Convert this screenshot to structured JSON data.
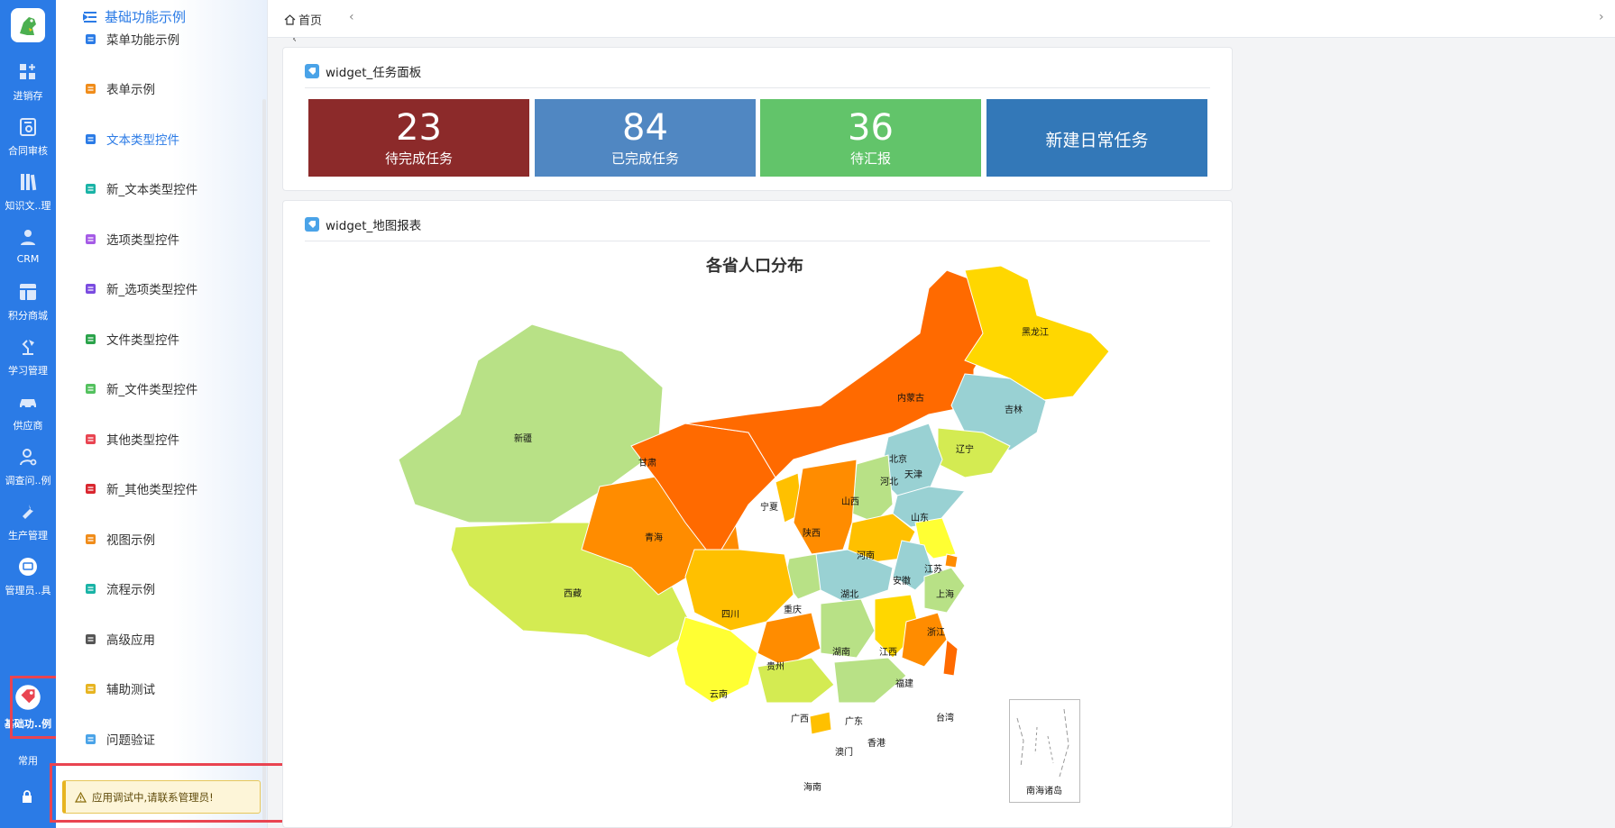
{
  "rail": {
    "items": [
      {
        "label": "进销存",
        "icon": "grid-plus-icon"
      },
      {
        "label": "合同审核",
        "icon": "contract-icon"
      },
      {
        "label": "知识文..理",
        "icon": "books-icon"
      },
      {
        "label": "CRM",
        "icon": "users-icon"
      },
      {
        "label": "积分商城",
        "icon": "layout-icon"
      },
      {
        "label": "学习管理",
        "icon": "lamp-icon"
      },
      {
        "label": "供应商",
        "icon": "car-icon"
      },
      {
        "label": "调查问..例",
        "icon": "user-search-icon"
      },
      {
        "label": "生产管理",
        "icon": "wrench-icon"
      },
      {
        "label": "管理员..具",
        "icon": "monitor-icon"
      },
      {
        "label": "基础功..例",
        "icon": "tag-icon"
      }
    ],
    "common_label": "常用"
  },
  "sidebar": {
    "header": "基础功能示例",
    "items": [
      {
        "label": "菜单功能示例",
        "icon": "list-icon",
        "color": "#2b7be6"
      },
      {
        "label": "表单示例",
        "icon": "table-icon",
        "color": "#f08c1a"
      },
      {
        "label": "文本类型控件",
        "icon": "doc-icon",
        "color": "#2b7be6"
      },
      {
        "label": "新_文本类型控件",
        "icon": "doc-icon",
        "color": "#19b3a6"
      },
      {
        "label": "选项类型控件",
        "icon": "checkbox-icon",
        "color": "#a55be6"
      },
      {
        "label": "新_选项类型控件",
        "icon": "checkbox-icon",
        "color": "#7a4be0"
      },
      {
        "label": "文件类型控件",
        "icon": "folder-icon",
        "color": "#2aa34a"
      },
      {
        "label": "新_文件类型控件",
        "icon": "folder-icon",
        "color": "#53c15e"
      },
      {
        "label": "其他类型控件",
        "icon": "cube-icon",
        "color": "#e94451"
      },
      {
        "label": "新_其他类型控件",
        "icon": "cubes-icon",
        "color": "#d9262f"
      },
      {
        "label": "视图示例",
        "icon": "columns-icon",
        "color": "#f08c1a"
      },
      {
        "label": "流程示例",
        "icon": "shuffle-icon",
        "color": "#19b3a6"
      },
      {
        "label": "高级应用",
        "icon": "checklist-icon",
        "color": "#555555"
      },
      {
        "label": "辅助测试",
        "icon": "hammer-icon",
        "color": "#e7b421"
      },
      {
        "label": "问题验证",
        "icon": "tag-icon",
        "color": "#4aa3e8"
      }
    ],
    "active_index": 2
  },
  "notice": {
    "text": "应用调试中,请联系管理员!"
  },
  "topbar": {
    "home_label": "首页"
  },
  "task_panel": {
    "title": "widget_任务面板",
    "tiles": [
      {
        "value": "23",
        "label": "待完成任务",
        "color": "#8c2a2a"
      },
      {
        "value": "84",
        "label": "已完成任务",
        "color": "#5087c2"
      },
      {
        "value": "36",
        "label": "待汇报",
        "color": "#62c46a"
      },
      {
        "value": "",
        "label": "新建日常任务",
        "color": "#3378b8"
      }
    ]
  },
  "map_panel": {
    "title": "widget_地图报表",
    "map_title": "各省人口分布",
    "inset_label": "南海诸岛"
  },
  "map_labels": [
    "黑龙江",
    "吉林",
    "辽宁",
    "内蒙古",
    "北京",
    "天津",
    "河北",
    "山西",
    "山东",
    "新疆",
    "甘肃",
    "宁夏",
    "陕西",
    "青海",
    "西藏",
    "河南",
    "江苏",
    "安徽",
    "上海",
    "湖北",
    "重庆",
    "四川",
    "浙江",
    "湖南",
    "江西",
    "贵州",
    "福建",
    "云南",
    "广西",
    "广东",
    "台湾",
    "香港",
    "澳门",
    "海南"
  ]
}
